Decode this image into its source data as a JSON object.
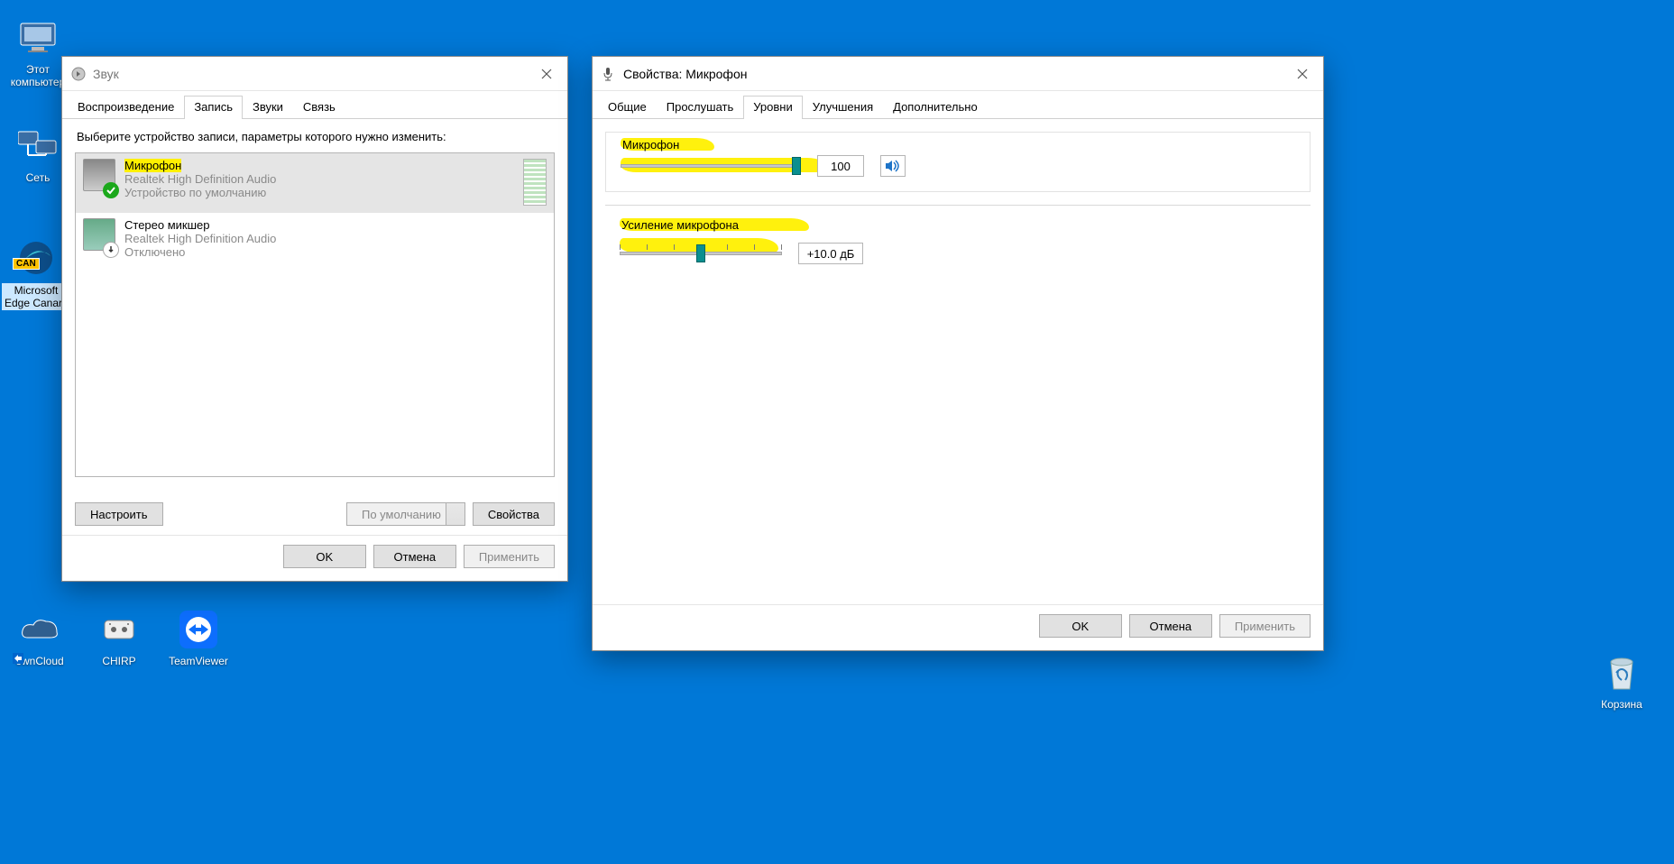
{
  "desktop": {
    "icons": [
      {
        "label": "Этот компьютер"
      },
      {
        "label": "Сеть"
      },
      {
        "label": "Microsoft Edge Canary",
        "selected": true,
        "can_badge": "CAN"
      },
      {
        "label": "ownCloud"
      },
      {
        "label": "CHIRP"
      },
      {
        "label": "TeamViewer"
      },
      {
        "label": "Корзина"
      }
    ]
  },
  "sound_window": {
    "title": "Звук",
    "tabs": [
      "Воспроизведение",
      "Запись",
      "Звуки",
      "Связь"
    ],
    "active_tab": 1,
    "instruction": "Выберите устройство записи, параметры которого нужно изменить:",
    "devices": [
      {
        "name": "Микрофон",
        "driver": "Realtek High Definition Audio",
        "status": "Устройство по умолчанию",
        "badge": "ok",
        "selected": true,
        "highlight": true
      },
      {
        "name": "Стерео микшер",
        "driver": "Realtek High Definition Audio",
        "status": "Отключено",
        "badge": "down",
        "selected": false
      }
    ],
    "btn_configure": "Настроить",
    "btn_default": "По умолчанию",
    "btn_properties": "Свойства",
    "btn_ok": "OK",
    "btn_cancel": "Отмена",
    "btn_apply": "Применить"
  },
  "props_window": {
    "title": "Свойства: Микрофон",
    "tabs": [
      "Общие",
      "Прослушать",
      "Уровни",
      "Улучшения",
      "Дополнительно"
    ],
    "active_tab": 2,
    "mic": {
      "label": "Микрофон",
      "value": 100,
      "value_text": "100",
      "percent": 100
    },
    "boost": {
      "label": "Усиление микрофона",
      "value_text": "+10.0 дБ",
      "ticks": 7,
      "tick_index": 3
    },
    "btn_ok": "OK",
    "btn_cancel": "Отмена",
    "btn_apply": "Применить"
  }
}
